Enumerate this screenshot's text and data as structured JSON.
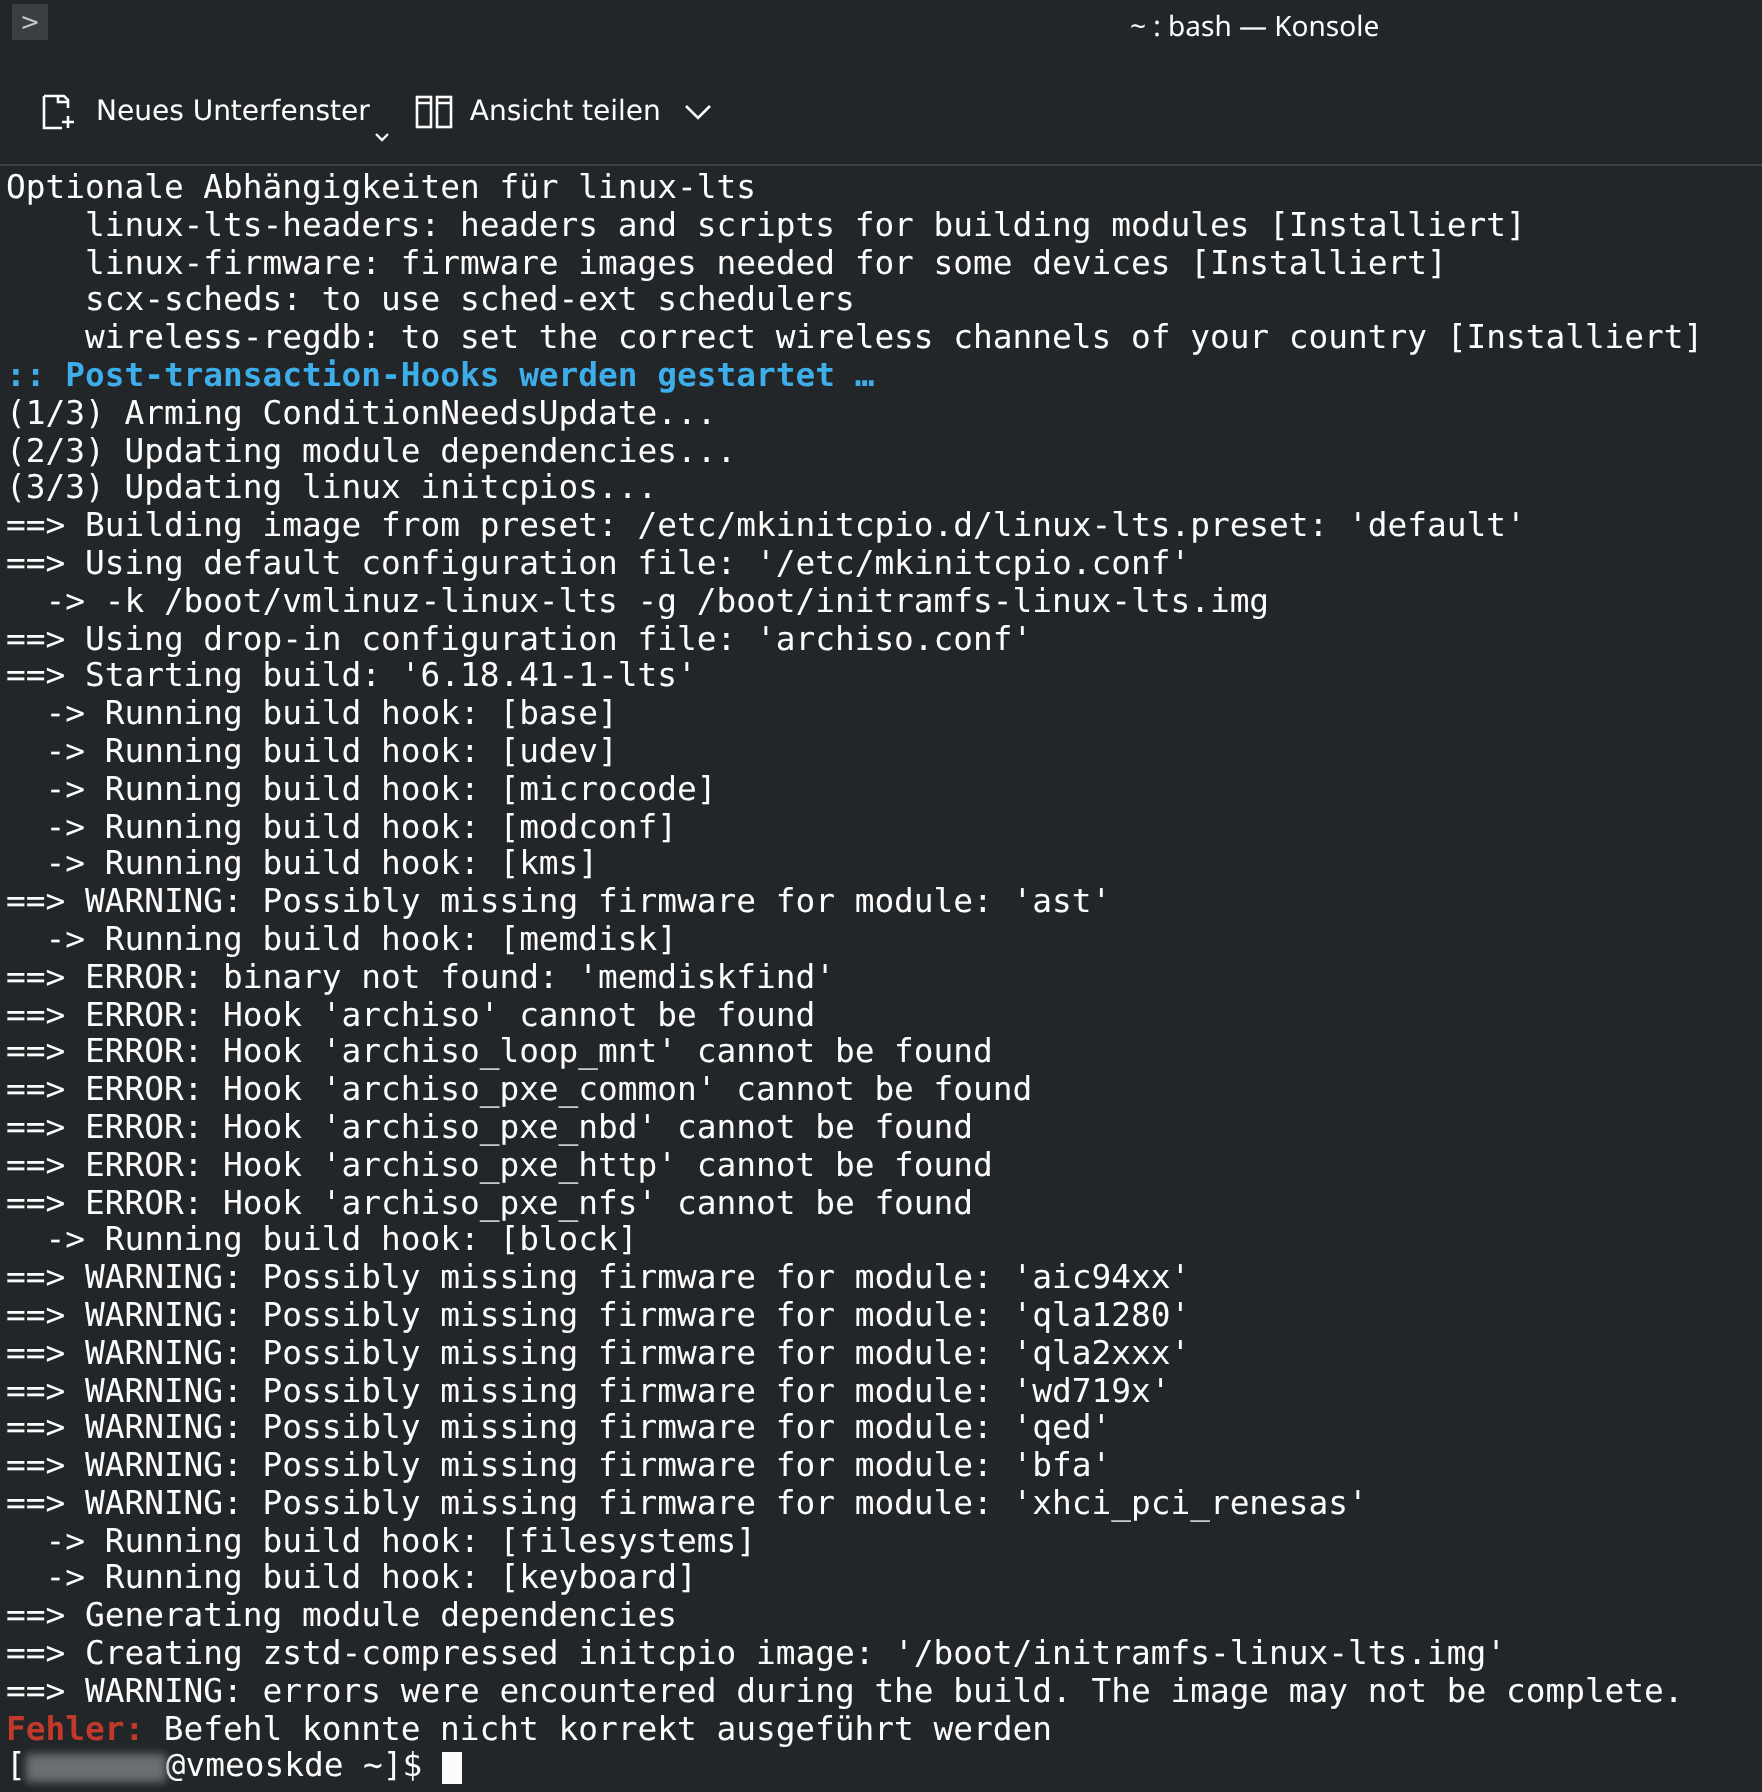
{
  "window": {
    "title": "~ : bash — Konsole",
    "menu_glyph": ">"
  },
  "toolbar": [
    {
      "label": "Neues Unterfenster",
      "kind": "new-tab"
    },
    {
      "label": "Ansicht teilen",
      "kind": "split"
    }
  ],
  "terminal": {
    "lines": [
      {
        "kind": "plain",
        "text": "Optionale Abhängigkeiten für linux-lts"
      },
      {
        "kind": "plain",
        "text": "    linux-lts-headers: headers and scripts for building modules [Installiert]"
      },
      {
        "kind": "plain",
        "text": "    linux-firmware: firmware images needed for some devices [Installiert]"
      },
      {
        "kind": "plain",
        "text": "    scx-scheds: to use sched-ext schedulers"
      },
      {
        "kind": "plain",
        "text": "    wireless-regdb: to set the correct wireless channels of your country [Installiert]"
      },
      {
        "kind": "hook",
        "text": ":: Post-transaction-Hooks werden gestartet …"
      },
      {
        "kind": "plain",
        "text": "(1/3) Arming ConditionNeedsUpdate..."
      },
      {
        "kind": "plain",
        "text": "(2/3) Updating module dependencies..."
      },
      {
        "kind": "plain",
        "text": "(3/3) Updating linux initcpios..."
      },
      {
        "kind": "plain",
        "text": "==> Building image from preset: /etc/mkinitcpio.d/linux-lts.preset: 'default'"
      },
      {
        "kind": "plain",
        "text": "==> Using default configuration file: '/etc/mkinitcpio.conf'"
      },
      {
        "kind": "plain",
        "text": "  -> -k /boot/vmlinuz-linux-lts -g /boot/initramfs-linux-lts.img"
      },
      {
        "kind": "plain",
        "text": "==> Using drop-in configuration file: 'archiso.conf'"
      },
      {
        "kind": "plain",
        "text": "==> Starting build: '6.18.41-1-lts'"
      },
      {
        "kind": "plain",
        "text": "  -> Running build hook: [base]"
      },
      {
        "kind": "plain",
        "text": "  -> Running build hook: [udev]"
      },
      {
        "kind": "plain",
        "text": "  -> Running build hook: [microcode]"
      },
      {
        "kind": "plain",
        "text": "  -> Running build hook: [modconf]"
      },
      {
        "kind": "plain",
        "text": "  -> Running build hook: [kms]"
      },
      {
        "kind": "plain",
        "text": "==> WARNING: Possibly missing firmware for module: 'ast'"
      },
      {
        "kind": "plain",
        "text": "  -> Running build hook: [memdisk]"
      },
      {
        "kind": "plain",
        "text": "==> ERROR: binary not found: 'memdiskfind'"
      },
      {
        "kind": "plain",
        "text": "==> ERROR: Hook 'archiso' cannot be found"
      },
      {
        "kind": "plain",
        "text": "==> ERROR: Hook 'archiso_loop_mnt' cannot be found"
      },
      {
        "kind": "plain",
        "text": "==> ERROR: Hook 'archiso_pxe_common' cannot be found"
      },
      {
        "kind": "plain",
        "text": "==> ERROR: Hook 'archiso_pxe_nbd' cannot be found"
      },
      {
        "kind": "plain",
        "text": "==> ERROR: Hook 'archiso_pxe_http' cannot be found"
      },
      {
        "kind": "plain",
        "text": "==> ERROR: Hook 'archiso_pxe_nfs' cannot be found"
      },
      {
        "kind": "plain",
        "text": "  -> Running build hook: [block]"
      },
      {
        "kind": "plain",
        "text": "==> WARNING: Possibly missing firmware for module: 'aic94xx'"
      },
      {
        "kind": "plain",
        "text": "==> WARNING: Possibly missing firmware for module: 'qla1280'"
      },
      {
        "kind": "plain",
        "text": "==> WARNING: Possibly missing firmware for module: 'qla2xxx'"
      },
      {
        "kind": "plain",
        "text": "==> WARNING: Possibly missing firmware for module: 'wd719x'"
      },
      {
        "kind": "plain",
        "text": "==> WARNING: Possibly missing firmware for module: 'qed'"
      },
      {
        "kind": "plain",
        "text": "==> WARNING: Possibly missing firmware for module: 'bfa'"
      },
      {
        "kind": "plain",
        "text": "==> WARNING: Possibly missing firmware for module: 'xhci_pci_renesas'"
      },
      {
        "kind": "plain",
        "text": "  -> Running build hook: [filesystems]"
      },
      {
        "kind": "plain",
        "text": "  -> Running build hook: [keyboard]"
      },
      {
        "kind": "plain",
        "text": "==> Generating module dependencies"
      },
      {
        "kind": "plain",
        "text": "==> Creating zstd-compressed initcpio image: '/boot/initramfs-linux-lts.img'"
      },
      {
        "kind": "plain",
        "text": "==> WARNING: errors were encountered during the build. The image may not be complete."
      },
      {
        "kind": "error",
        "label": "Fehler:",
        "text": "Befehl konnte nicht korrekt ausgeführt werden"
      }
    ],
    "prompt": {
      "open": "[",
      "rest": "@vmeoskde ~]$"
    }
  }
}
